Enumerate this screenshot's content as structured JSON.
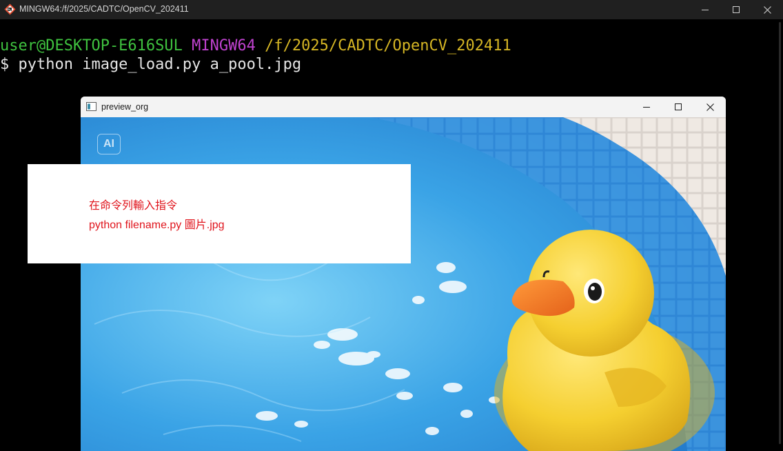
{
  "terminal": {
    "title": "MINGW64:/f/2025/CADTC/OpenCV_202411",
    "prompt": {
      "user_host": "user@DESKTOP-E616SUL",
      "env": "MINGW64",
      "path": "/f/2025/CADTC/OpenCV_202411"
    },
    "command_line": "$ python image_load.py a_pool.jpg",
    "controls": {
      "minimize": "minimize-icon",
      "maximize": "maximize-icon",
      "close": "close-icon"
    },
    "colors": {
      "user_host": "#3fc23f",
      "env": "#c042d0",
      "path": "#d6b624",
      "background": "#000000"
    }
  },
  "preview_window": {
    "title": "preview_org",
    "image": {
      "description_icon": "rubber-duck-pool-image",
      "badge": "AI"
    },
    "controls": {
      "minimize": "minimize-icon",
      "maximize": "maximize-icon",
      "close": "close-icon"
    }
  },
  "annotation": {
    "line1": "在命令列輸入指令",
    "line2": "python filename.py 圖片.jpg",
    "color": "#e0141c"
  }
}
